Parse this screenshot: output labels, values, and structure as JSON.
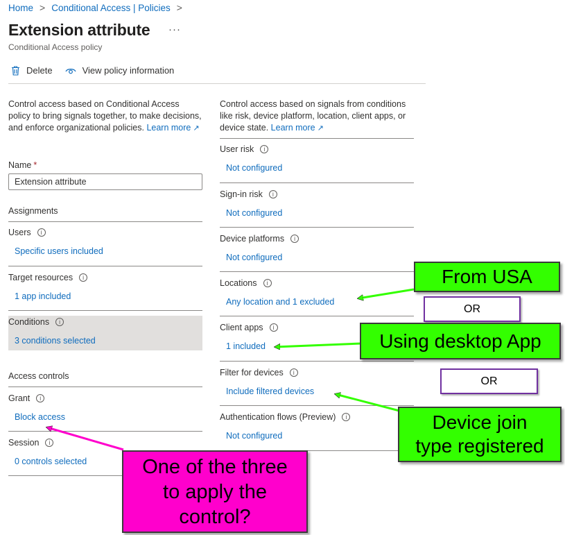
{
  "breadcrumb": {
    "home": "Home",
    "policies": "Conditional Access | Policies",
    "separator": ">"
  },
  "page": {
    "title": "Extension attribute",
    "more": "···",
    "subtitle": "Conditional Access policy"
  },
  "toolbar": {
    "delete_label": "Delete",
    "view_label": "View policy information"
  },
  "left": {
    "description": "Control access based on Conditional Access policy to bring signals together, to make decisions, and enforce organizational policies.",
    "learn_more": "Learn more",
    "name_label": "Name",
    "required_mark": "*",
    "name_value": "Extension attribute",
    "assignments_heading": "Assignments",
    "users_label": "Users",
    "users_value": "Specific users included",
    "target_label": "Target resources",
    "target_value": "1 app included",
    "conditions_label": "Conditions",
    "conditions_value": "3 conditions selected",
    "access_heading": "Access controls",
    "grant_label": "Grant",
    "grant_value": "Block access",
    "session_label": "Session",
    "session_value": "0 controls selected"
  },
  "right": {
    "description": "Control access based on signals from conditions like risk, device platform, location, client apps, or device state.",
    "learn_more": "Learn more",
    "items": [
      {
        "label": "User risk",
        "value": "Not configured"
      },
      {
        "label": "Sign-in risk",
        "value": "Not configured"
      },
      {
        "label": "Device platforms",
        "value": "Not configured"
      },
      {
        "label": "Locations",
        "value": "Any location and 1 excluded"
      },
      {
        "label": "Client apps",
        "value": "1 included"
      },
      {
        "label": "Filter for devices",
        "value": "Include filtered devices"
      },
      {
        "label": "Authentication flows (Preview)",
        "value": "Not configured"
      }
    ]
  },
  "annotations": {
    "from_usa": "From USA",
    "or_1": "OR",
    "desktop_app": "Using desktop App",
    "or_2": "OR",
    "device_join_line1": "Device join",
    "device_join_line2": "type registered",
    "question_line1": "One of the three",
    "question_line2": "to apply the",
    "question_line3": "control?"
  },
  "colors": {
    "link": "#0f6cbd",
    "callout_green": "#33ff00",
    "callout_pink": "#ff00cc",
    "or_border": "#7030a0"
  },
  "icons": {
    "delete": "trash-icon",
    "view": "eye-icon",
    "info": "info-icon",
    "external": "external-link-icon"
  }
}
